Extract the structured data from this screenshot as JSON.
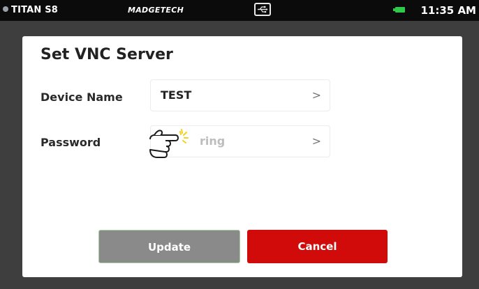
{
  "status_bar": {
    "device_label": "TITAN S8",
    "brand": "MADGETECH",
    "time": "11:35 AM",
    "indicator_icon": "status-dot-icon",
    "usb_icon": "usb-icon",
    "battery_icon": "battery-icon",
    "battery_color": "#2ec84a"
  },
  "dialog": {
    "title": "Set VNC Server",
    "fields": [
      {
        "label": "Device Name",
        "value": "TEST",
        "chevron": ">"
      },
      {
        "label": "Password",
        "placeholder": "ring",
        "chevron": ">"
      }
    ],
    "buttons": {
      "update_label": "Update",
      "cancel_label": "Cancel"
    }
  },
  "colors": {
    "cancel_red": "#d10a0a",
    "update_gray": "#8a8a8a"
  },
  "cursor_icon": "pointing-hand-icon"
}
